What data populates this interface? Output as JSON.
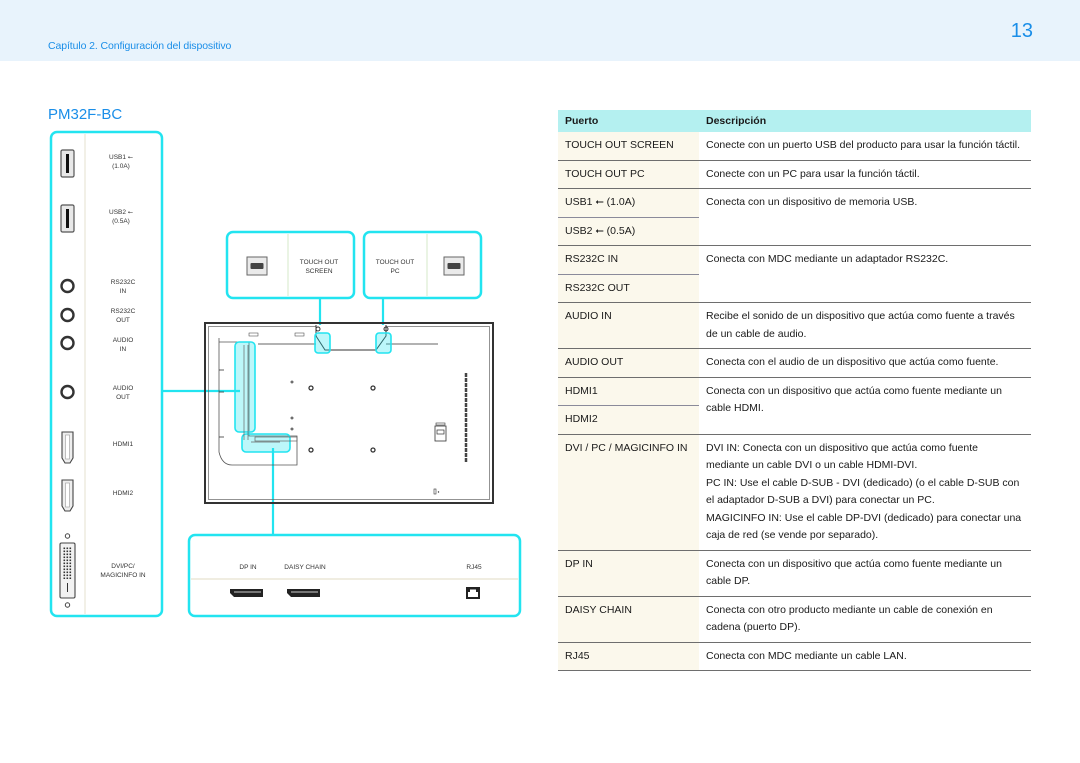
{
  "header": {
    "chapter": "Capítulo 2. Configuración del dispositivo",
    "page_number": "13",
    "accent_color": "#1a8ee8",
    "band_color": "#e8f3fc"
  },
  "model": "PM32F-BC",
  "diagram": {
    "highlight_color": "#22e4f0",
    "side_panel": [
      {
        "label": "USB1 ⭠\n(1.0A)",
        "icon": "usb-a-port-icon"
      },
      {
        "label": "USB2 ⭠\n(0.5A)",
        "icon": "usb-a-port-icon"
      },
      {
        "label": "RS232C\nIN",
        "icon": "round-jack-icon"
      },
      {
        "label": "RS232C\nOUT",
        "icon": "round-jack-icon"
      },
      {
        "label": "AUDIO\nIN",
        "icon": "round-jack-icon"
      },
      {
        "label": "AUDIO\nOUT",
        "icon": "round-jack-icon"
      },
      {
        "label": "HDMI1",
        "icon": "hdmi-port-icon"
      },
      {
        "label": "HDMI2",
        "icon": "hdmi-port-icon"
      },
      {
        "label": "DVI/PC/\nMAGICINFO IN",
        "icon": "dvi-port-icon"
      }
    ],
    "touch_screen": {
      "label": "TOUCH OUT\nSCREEN",
      "icon": "usb-b-port-icon"
    },
    "touch_pc": {
      "label": "TOUCH OUT\nPC",
      "icon": "usb-b-port-icon"
    },
    "bottom_panel": [
      {
        "label": "DP IN",
        "icon": "displayport-icon"
      },
      {
        "label": "DAISY CHAIN",
        "icon": "displayport-icon"
      },
      {
        "label": "RJ45",
        "icon": "rj45-port-icon"
      }
    ]
  },
  "table": {
    "header_color": "#b4f0f0",
    "columns": [
      "Puerto",
      "Descripción"
    ],
    "rows": [
      {
        "ports": [
          "TOUCH OUT SCREEN"
        ],
        "description": [
          "Conecte con un puerto USB del producto para usar la función táctil."
        ]
      },
      {
        "ports": [
          "TOUCH OUT PC"
        ],
        "description": [
          "Conecte con un PC para usar la función táctil."
        ]
      },
      {
        "ports": [
          "USB1 ⭠ (1.0A)",
          "USB2 ⭠ (0.5A)"
        ],
        "description": [
          "Conecta con un dispositivo de memoria USB."
        ]
      },
      {
        "ports": [
          "RS232C IN",
          "RS232C OUT"
        ],
        "description": [
          "Conecta con MDC mediante un adaptador RS232C."
        ]
      },
      {
        "ports": [
          "AUDIO IN"
        ],
        "description": [
          "Recibe el sonido de un dispositivo que actúa como fuente a través de un cable de audio."
        ]
      },
      {
        "ports": [
          "AUDIO OUT"
        ],
        "description": [
          "Conecta con el audio de un dispositivo que actúa como fuente."
        ]
      },
      {
        "ports": [
          "HDMI1",
          "HDMI2"
        ],
        "description": [
          "Conecta con un dispositivo que actúa como fuente mediante un cable HDMI."
        ]
      },
      {
        "ports": [
          "DVI / PC / MAGICINFO IN"
        ],
        "description": [
          "DVI IN: Conecta con un dispositivo que actúa como fuente mediante un cable DVI o un cable HDMI-DVI.",
          "PC IN: Use el cable D-SUB - DVI (dedicado) (o el cable D-SUB con el adaptador D-SUB a DVI) para conectar un PC.",
          "MAGICINFO IN: Use el cable DP-DVI (dedicado) para conectar una caja de red (se vende por separado)."
        ]
      },
      {
        "ports": [
          "DP IN"
        ],
        "description": [
          "Conecta con un dispositivo que actúa como fuente mediante un cable DP."
        ]
      },
      {
        "ports": [
          "DAISY CHAIN"
        ],
        "description": [
          "Conecta con otro producto mediante un cable de conexión en cadena (puerto DP)."
        ]
      },
      {
        "ports": [
          "RJ45"
        ],
        "description": [
          "Conecta con MDC mediante un cable LAN."
        ]
      }
    ]
  }
}
